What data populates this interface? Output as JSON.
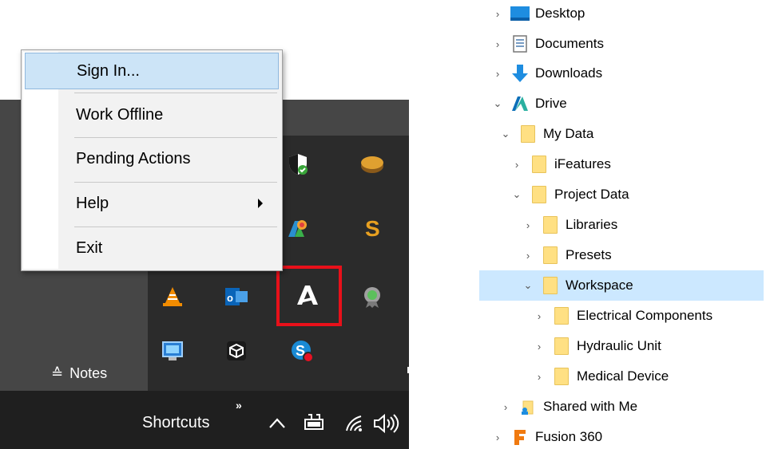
{
  "context_menu": {
    "items": [
      {
        "label": "Sign In...",
        "state": "hover"
      },
      {
        "label": "Work Offline"
      },
      {
        "label": "Pending Actions"
      },
      {
        "label": "Help",
        "has_submenu": true
      },
      {
        "label": "Exit"
      }
    ]
  },
  "tray": {
    "notes_label": "Notes",
    "shortcuts_label": "Shortcuts",
    "more_glyph": "»",
    "icons": [
      {
        "name": "windows-security-icon"
      },
      {
        "name": "disk-icon"
      },
      {
        "name": "autodesk-color-icon"
      },
      {
        "name": "s-icon"
      },
      {
        "name": "vlc-icon"
      },
      {
        "name": "outlook-icon"
      },
      {
        "name": "autodesk-drive-icon"
      },
      {
        "name": "certificate-icon"
      },
      {
        "name": "monitor-icon"
      },
      {
        "name": "cube-icon"
      },
      {
        "name": "skype-icon"
      }
    ],
    "highlight_color": "#e8101a"
  },
  "tree": {
    "rows": [
      {
        "label": "Desktop",
        "icon": "desktop-icon",
        "expanded": false
      },
      {
        "label": "Documents",
        "icon": "documents-icon",
        "expanded": false
      },
      {
        "label": "Downloads",
        "icon": "downloads-icon",
        "expanded": false
      },
      {
        "label": "Drive",
        "icon": "autodesk-drive-icon",
        "expanded": true
      },
      {
        "label": "My Data",
        "icon": "folder-icon",
        "expanded": true
      },
      {
        "label": "iFeatures",
        "icon": "folder-icon",
        "expanded": false
      },
      {
        "label": "Project Data",
        "icon": "folder-icon",
        "expanded": true
      },
      {
        "label": "Libraries",
        "icon": "folder-icon",
        "expanded": false
      },
      {
        "label": "Presets",
        "icon": "folder-icon",
        "expanded": false
      },
      {
        "label": "Workspace",
        "icon": "folder-icon",
        "expanded": true,
        "selected": true
      },
      {
        "label": "Electrical Components",
        "icon": "folder-icon",
        "expanded": false
      },
      {
        "label": "Hydraulic Unit",
        "icon": "folder-icon",
        "expanded": false
      },
      {
        "label": "Medical Device",
        "icon": "folder-icon",
        "expanded": false
      },
      {
        "label": "Shared with Me",
        "icon": "shared-folder-icon",
        "expanded": false
      },
      {
        "label": "Fusion 360",
        "icon": "fusion-icon",
        "expanded": false
      }
    ]
  },
  "colors": {
    "menu_hover": "#cce4f7",
    "tree_selected": "#cce8ff",
    "folder": "#ffe083"
  }
}
